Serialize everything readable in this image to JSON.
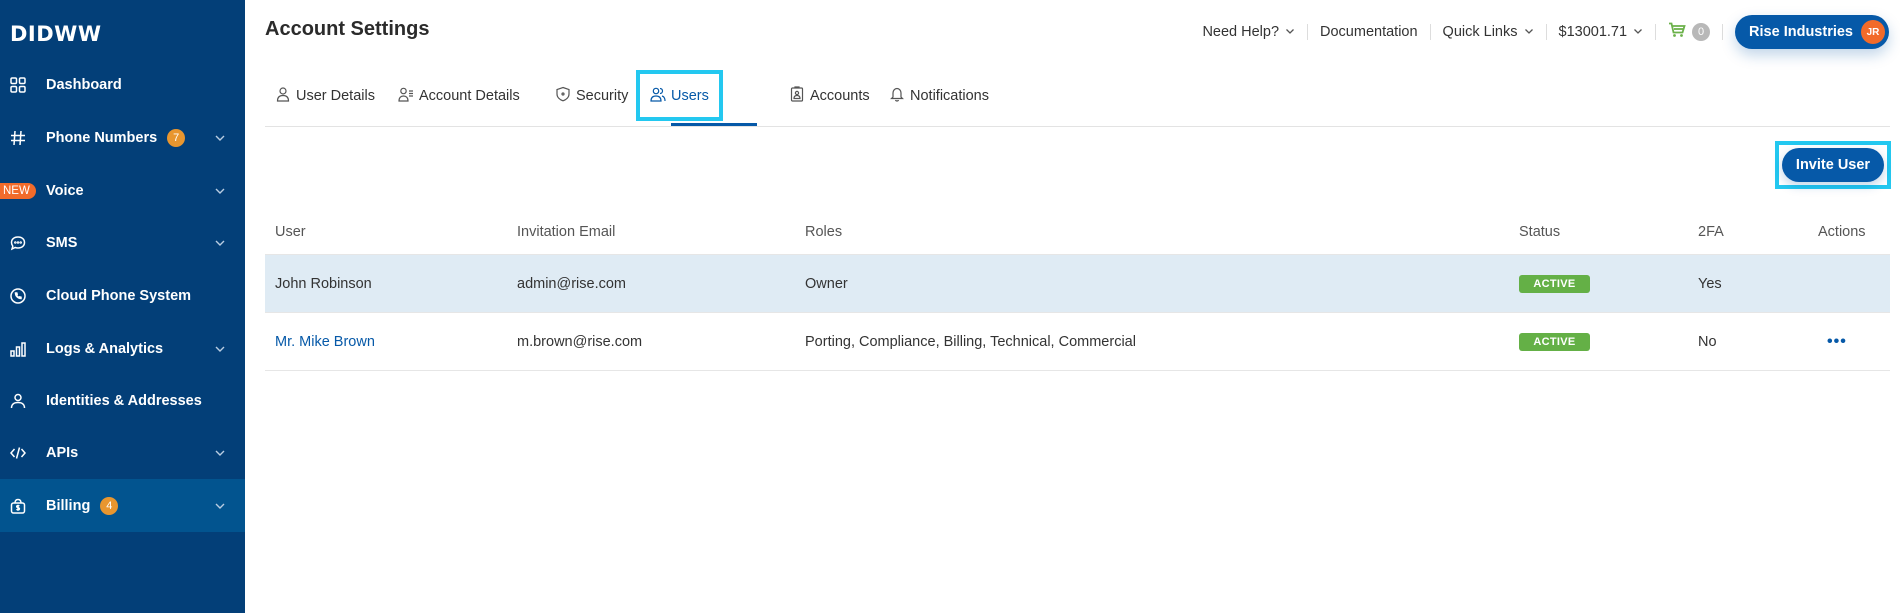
{
  "brand": {
    "logo": "DIDWW",
    "primary": "#0659a8",
    "sidebar_bg": "#033f78",
    "highlight": "#23c8f0"
  },
  "sidebar": {
    "items": [
      {
        "label": "Dashboard",
        "icon": "grid-icon",
        "badge": null,
        "chevron": false
      },
      {
        "label": "Phone Numbers",
        "icon": "hash-icon",
        "badge": "7",
        "chevron": true
      },
      {
        "label": "Voice",
        "icon": "new-badge",
        "badge": null,
        "chevron": true,
        "tag": "NEW"
      },
      {
        "label": "SMS",
        "icon": "chat-icon",
        "badge": null,
        "chevron": true
      },
      {
        "label": "Cloud Phone System",
        "icon": "phone-circle-icon",
        "badge": null,
        "chevron": false
      },
      {
        "label": "Logs & Analytics",
        "icon": "bar-chart-icon",
        "badge": null,
        "chevron": true
      },
      {
        "label": "Identities & Addresses",
        "icon": "person-icon",
        "badge": null,
        "chevron": false
      },
      {
        "label": "APIs",
        "icon": "code-icon",
        "badge": null,
        "chevron": true
      },
      {
        "label": "Billing",
        "icon": "money-bag-icon",
        "badge": "4",
        "chevron": true,
        "active": true
      }
    ]
  },
  "header": {
    "title": "Account Settings",
    "need_help": "Need Help?",
    "documentation": "Documentation",
    "quick_links": "Quick Links",
    "balance": "$13001.71",
    "cart_count": "0",
    "account_name": "Rise Industries",
    "avatar_initials": "JR"
  },
  "tabs": [
    {
      "label": "User Details",
      "icon": "user-icon"
    },
    {
      "label": "Account Details",
      "icon": "user-list-icon"
    },
    {
      "label": "Security",
      "icon": "shield-icon"
    },
    {
      "label": "Users",
      "icon": "users-icon",
      "active": true
    },
    {
      "label": "Accounts",
      "icon": "badge-icon"
    },
    {
      "label": "Notifications",
      "icon": "bell-icon"
    }
  ],
  "invite_button": "Invite User",
  "table": {
    "columns": [
      "User",
      "Invitation Email",
      "Roles",
      "Status",
      "2FA",
      "Actions"
    ],
    "rows": [
      {
        "user": "John Robinson",
        "email": "admin@rise.com",
        "roles": "Owner",
        "status": "ACTIVE",
        "twofa": "Yes",
        "actions": "",
        "link": false
      },
      {
        "user": "Mr. Mike Brown",
        "email": "m.brown@rise.com",
        "roles": "Porting, Compliance, Billing, Technical, Commercial",
        "status": "ACTIVE",
        "twofa": "No",
        "actions": "•••",
        "link": true
      }
    ]
  }
}
